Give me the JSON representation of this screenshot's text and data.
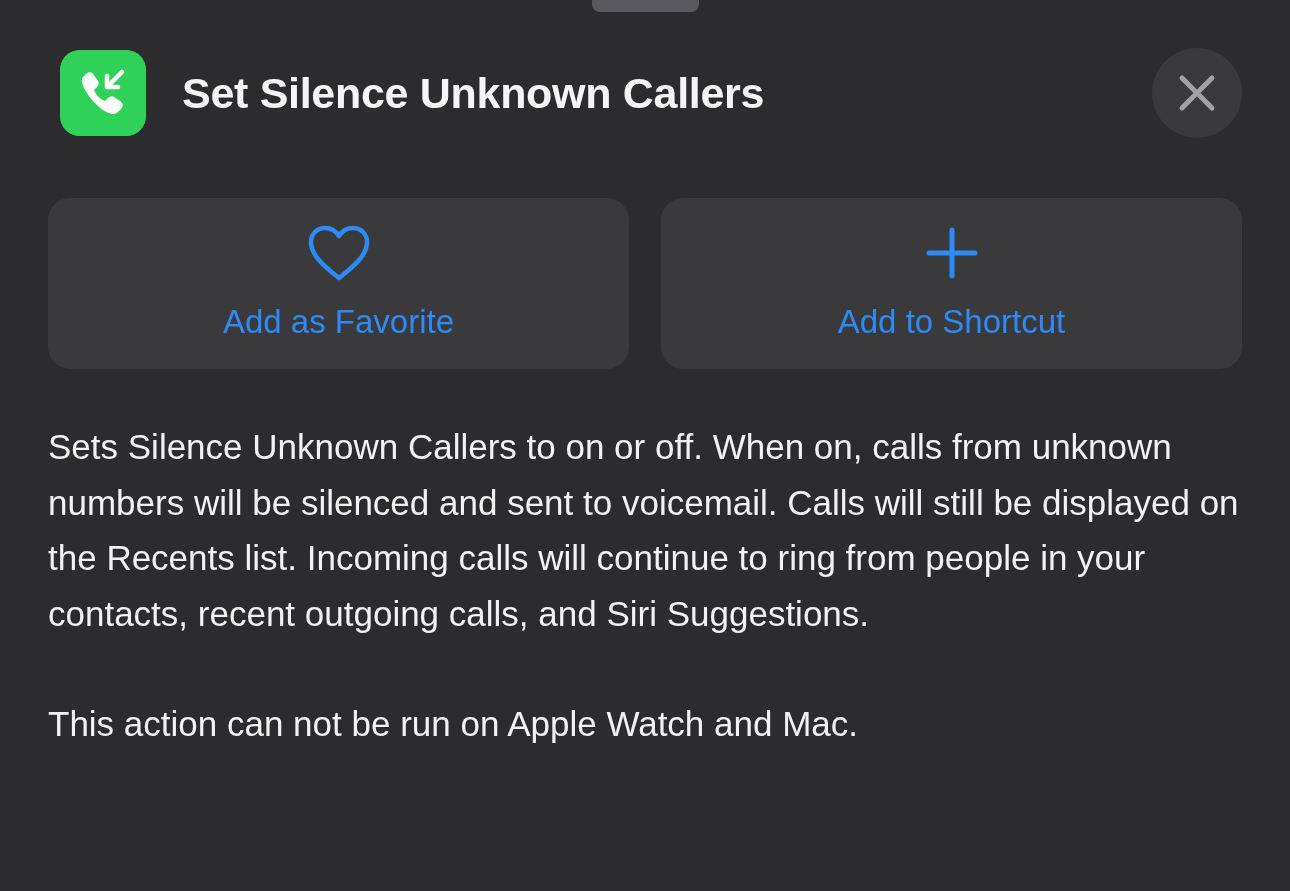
{
  "sheet": {
    "title": "Set Silence Unknown Callers"
  },
  "actions": [
    {
      "kind": "favorite",
      "label": "Add as Favorite"
    },
    {
      "kind": "add",
      "label": "Add to Shortcut"
    }
  ],
  "description": [
    "Sets Silence Unknown Callers to on or off. When on, calls from unknown numbers will be silenced and sent to voicemail. Calls will still be displayed on the Recents list. Incoming calls will continue to ring from people in your contacts, recent outgoing calls, and Siri Suggestions.",
    "This action can not be run on Apple Watch and Mac."
  ]
}
